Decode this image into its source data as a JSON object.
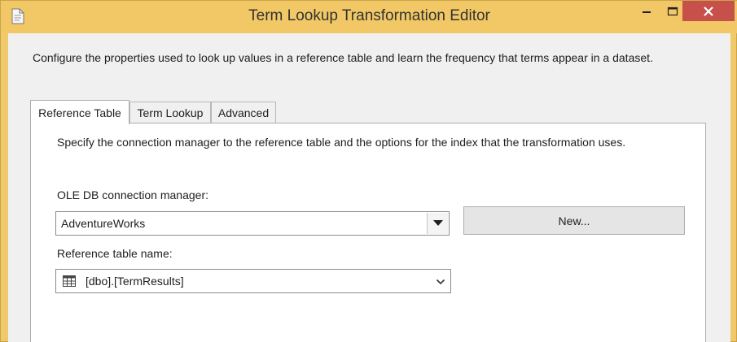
{
  "window": {
    "title": "Term Lookup Transformation Editor",
    "icon": "document-icon",
    "controls": [
      "minimize-icon",
      "maximize-icon",
      "close-icon"
    ]
  },
  "intro": "Configure the properties used to look up values in a reference table and learn the frequency that terms appear in a dataset.",
  "tabs": [
    {
      "label": "Reference Table",
      "active": true
    },
    {
      "label": "Term Lookup",
      "active": false
    },
    {
      "label": "Advanced",
      "active": false
    }
  ],
  "panel": {
    "description": "Specify the connection manager to the reference table and the options for the index that the transformation uses.",
    "connection": {
      "label": "OLE DB connection manager:",
      "value": "AdventureWorks"
    },
    "new_button": "New...",
    "reference_table": {
      "label": "Reference table name:",
      "value": "[dbo].[TermResults]",
      "icon": "table-icon"
    }
  },
  "colors": {
    "titlebar": "#f1c865",
    "close_button": "#c7504b",
    "client_background": "#f0f0f0"
  }
}
